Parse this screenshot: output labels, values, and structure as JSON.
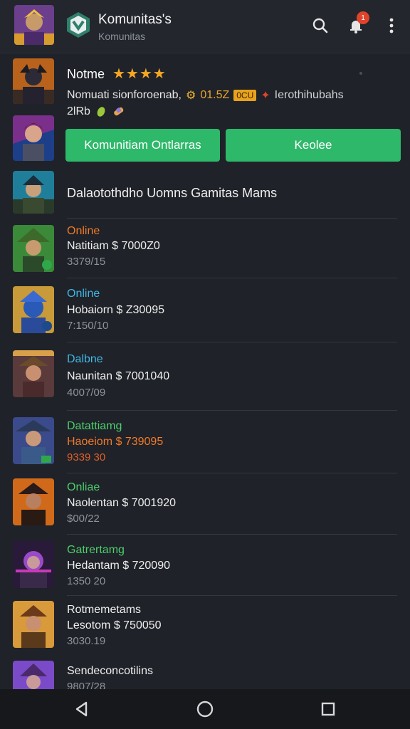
{
  "header": {
    "title": "Komunitas's",
    "subtitle": "Komunitas",
    "notif_count": "1"
  },
  "featured": {
    "name": "Notme",
    "stars": "★★★★",
    "stats": {
      "line_start": "Nomuati sionforoenab,",
      "gold_value": "01.5Z",
      "tag": "0CU",
      "line_end": "Ierothihubahs"
    },
    "sub": "2lRb",
    "primary_button": "Komunitiam Ontlarras",
    "secondary_button": "Keolee"
  },
  "section_title": "Dalaotothdho Uomns Gamitas Mams",
  "members": [
    {
      "status": "Online",
      "status_color": "#f07a2a",
      "line1": "Natitiam $ 7000Z0",
      "line2": "3379/15",
      "line2_color": "#8e939b"
    },
    {
      "status": "Online",
      "status_color": "#3fb8e6",
      "line1": "Hobaiorn $ Z30095",
      "line2": "7:150/10",
      "line2_color": "#8e939b"
    },
    {
      "status": "Dalbne",
      "status_color": "#3fb8e6",
      "line1": "Naunitan $ 7001040",
      "line2": "4007/09",
      "line2_color": "#8e939b"
    },
    {
      "status": "Datattiamg",
      "status_color": "#4ccf6c",
      "line1": "Haoeiom $ 739095",
      "line1_color": "#f07a2a",
      "line2": "9339 30",
      "line2_color": "#e0602a"
    },
    {
      "status": "Onliae",
      "status_color": "#4ccf6c",
      "line1": "Naolentan $ 7001920",
      "line2": "$00/22",
      "line2_color": "#8e939b"
    },
    {
      "status": "Gatrertamg",
      "status_color": "#4ccf6c",
      "line1": "Hedantam $ 720090",
      "line2": "1350 20",
      "line2_color": "#8e939b"
    },
    {
      "status": "Rotmemetams",
      "status_color": "#eeeeee",
      "line1": "Lesotom $ 750050",
      "line2": "3030.19",
      "line2_color": "#8e939b"
    },
    {
      "status": "Sendeconcotilins",
      "status_color": "#eeeeee",
      "line1": "",
      "line2": "9807/28",
      "line2_color": "#8e939b"
    }
  ]
}
